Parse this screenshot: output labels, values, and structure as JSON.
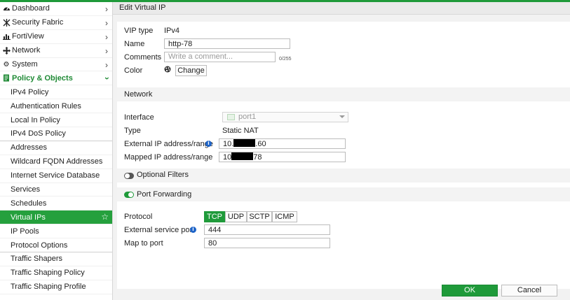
{
  "header": {
    "title": "Edit Virtual IP"
  },
  "sidebar": {
    "top_items": [
      {
        "label": "Dashboard",
        "icon": "dashboard-icon"
      },
      {
        "label": "Security Fabric",
        "icon": "security-fabric-icon"
      },
      {
        "label": "FortiView",
        "icon": "fortiview-icon"
      },
      {
        "label": "Network",
        "icon": "network-icon"
      },
      {
        "label": "System",
        "icon": "gear-icon"
      }
    ],
    "section": {
      "label": "Policy & Objects",
      "icon": "policy-objects-icon"
    },
    "sub_items": [
      "IPv4 Policy",
      "Authentication Rules",
      "Local In Policy",
      "IPv4 DoS Policy",
      "Addresses",
      "Wildcard FQDN Addresses",
      "Internet Service Database",
      "Services",
      "Schedules",
      "Virtual IPs",
      "IP Pools",
      "Protocol Options",
      "Traffic Shapers",
      "Traffic Shaping Policy",
      "Traffic Shaping Profile"
    ],
    "active_item": "Virtual IPs"
  },
  "form": {
    "vip_type_label": "VIP type",
    "vip_type_value": "IPv4",
    "name_label": "Name",
    "name_value": "http-78",
    "comments_label": "Comments",
    "comments_placeholder": "Write a comment...",
    "comments_counter": "0/255",
    "color_label": "Color",
    "change_button": "Change",
    "network_section": "Network",
    "interface_label": "Interface",
    "interface_value": "port1",
    "type_label": "Type",
    "type_value": "Static NAT",
    "external_ip_label": "External IP address/range",
    "external_ip_prefix": "10.",
    "external_ip_suffix": ".60",
    "mapped_ip_label": "Mapped IP address/range",
    "mapped_ip_prefix": "10",
    "mapped_ip_suffix": "78",
    "optional_filters_label": "Optional Filters",
    "optional_filters_enabled": false,
    "port_forwarding_label": "Port Forwarding",
    "port_forwarding_enabled": true,
    "protocol_label": "Protocol",
    "protocols": [
      "TCP",
      "UDP",
      "SCTP",
      "ICMP"
    ],
    "protocol_selected": "TCP",
    "external_port_label": "External service port",
    "external_port_value": "444",
    "map_to_port_label": "Map to port",
    "map_to_port_value": "80"
  },
  "footer": {
    "ok_label": "OK",
    "cancel_label": "Cancel"
  },
  "colors": {
    "accent": "#1f9a3a",
    "info": "#1e64c8"
  }
}
